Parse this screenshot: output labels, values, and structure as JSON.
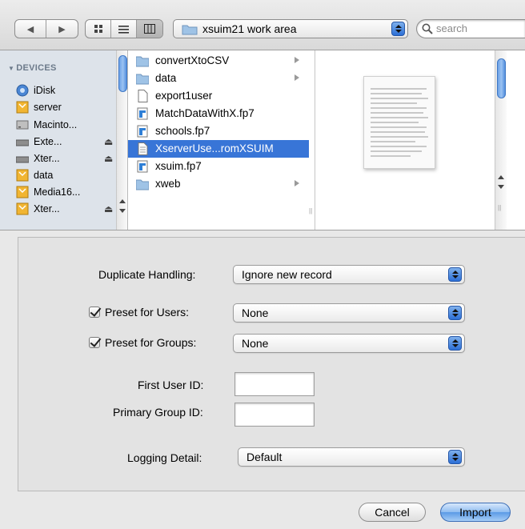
{
  "toolbar": {
    "back_icon": "chevron-left",
    "forward_icon": "chevron-right",
    "view_modes": [
      "icon",
      "list",
      "column"
    ],
    "active_view": "column",
    "path_label": "xsuim21 work area",
    "search_placeholder": "search"
  },
  "sidebar": {
    "section_title": "DEVICES",
    "items": [
      {
        "label": "iDisk",
        "icon": "idisk-icon"
      },
      {
        "label": "server",
        "icon": "server-volume-icon"
      },
      {
        "label": "Macinto...",
        "icon": "hard-drive-icon"
      },
      {
        "label": "Exte...",
        "icon": "external-drive-icon",
        "eject": "⏏"
      },
      {
        "label": "Xter...",
        "icon": "external-drive-icon",
        "eject": "⏏"
      },
      {
        "label": "data",
        "icon": "server-volume-icon"
      },
      {
        "label": "Media16...",
        "icon": "server-volume-icon"
      },
      {
        "label": "Xter...",
        "icon": "server-volume-icon",
        "eject": "⏏"
      }
    ]
  },
  "files": [
    {
      "name": "convertXtoCSV",
      "type": "folder"
    },
    {
      "name": "data",
      "type": "folder"
    },
    {
      "name": "export1user",
      "type": "document"
    },
    {
      "name": "MatchDataWithX.fp7",
      "type": "filemaker"
    },
    {
      "name": "schools.fp7",
      "type": "filemaker"
    },
    {
      "name": "XserverUse...romXSUIM",
      "type": "text",
      "selected": true
    },
    {
      "name": "xsuim.fp7",
      "type": "filemaker"
    },
    {
      "name": "xweb",
      "type": "folder"
    }
  ],
  "form": {
    "duplicate_label": "Duplicate Handling:",
    "duplicate_value": "Ignore new record",
    "preset_users_label": "Preset for Users:",
    "preset_users_value": "None",
    "preset_users_checked": true,
    "preset_groups_label": "Preset for Groups:",
    "preset_groups_value": "None",
    "preset_groups_checked": true,
    "first_user_id_label": "First User ID:",
    "first_user_id_value": "",
    "primary_group_id_label": "Primary Group ID:",
    "primary_group_id_value": "",
    "logging_label": "Logging Detail:",
    "logging_value": "Default"
  },
  "buttons": {
    "cancel": "Cancel",
    "import": "Import"
  },
  "colors": {
    "selection": "#3875d7",
    "sidebar_bg": "#dde3ea",
    "accent_blue": "#2c6fd6"
  }
}
